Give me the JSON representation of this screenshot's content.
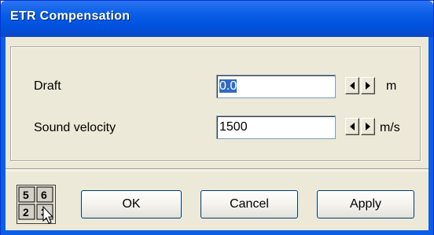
{
  "window": {
    "title": "ETR Compensation"
  },
  "fields": [
    {
      "label": "Draft",
      "value": "0.0",
      "unit": "m"
    },
    {
      "label": "Sound velocity",
      "value": "1500",
      "unit": "m/s"
    }
  ],
  "buttons": {
    "ok": "OK",
    "cancel": "Cancel",
    "apply": "Apply"
  },
  "numpad": {
    "digits": [
      "5",
      "6",
      "2",
      "3"
    ]
  },
  "icons": {
    "numpad": "numeric-keypad-icon",
    "spin_left": "left-arrow-icon",
    "spin_right": "right-arrow-icon"
  },
  "colors": {
    "titlebar": "#0a5fe6",
    "selection": "#316ac5",
    "face": "#ece9d8"
  }
}
